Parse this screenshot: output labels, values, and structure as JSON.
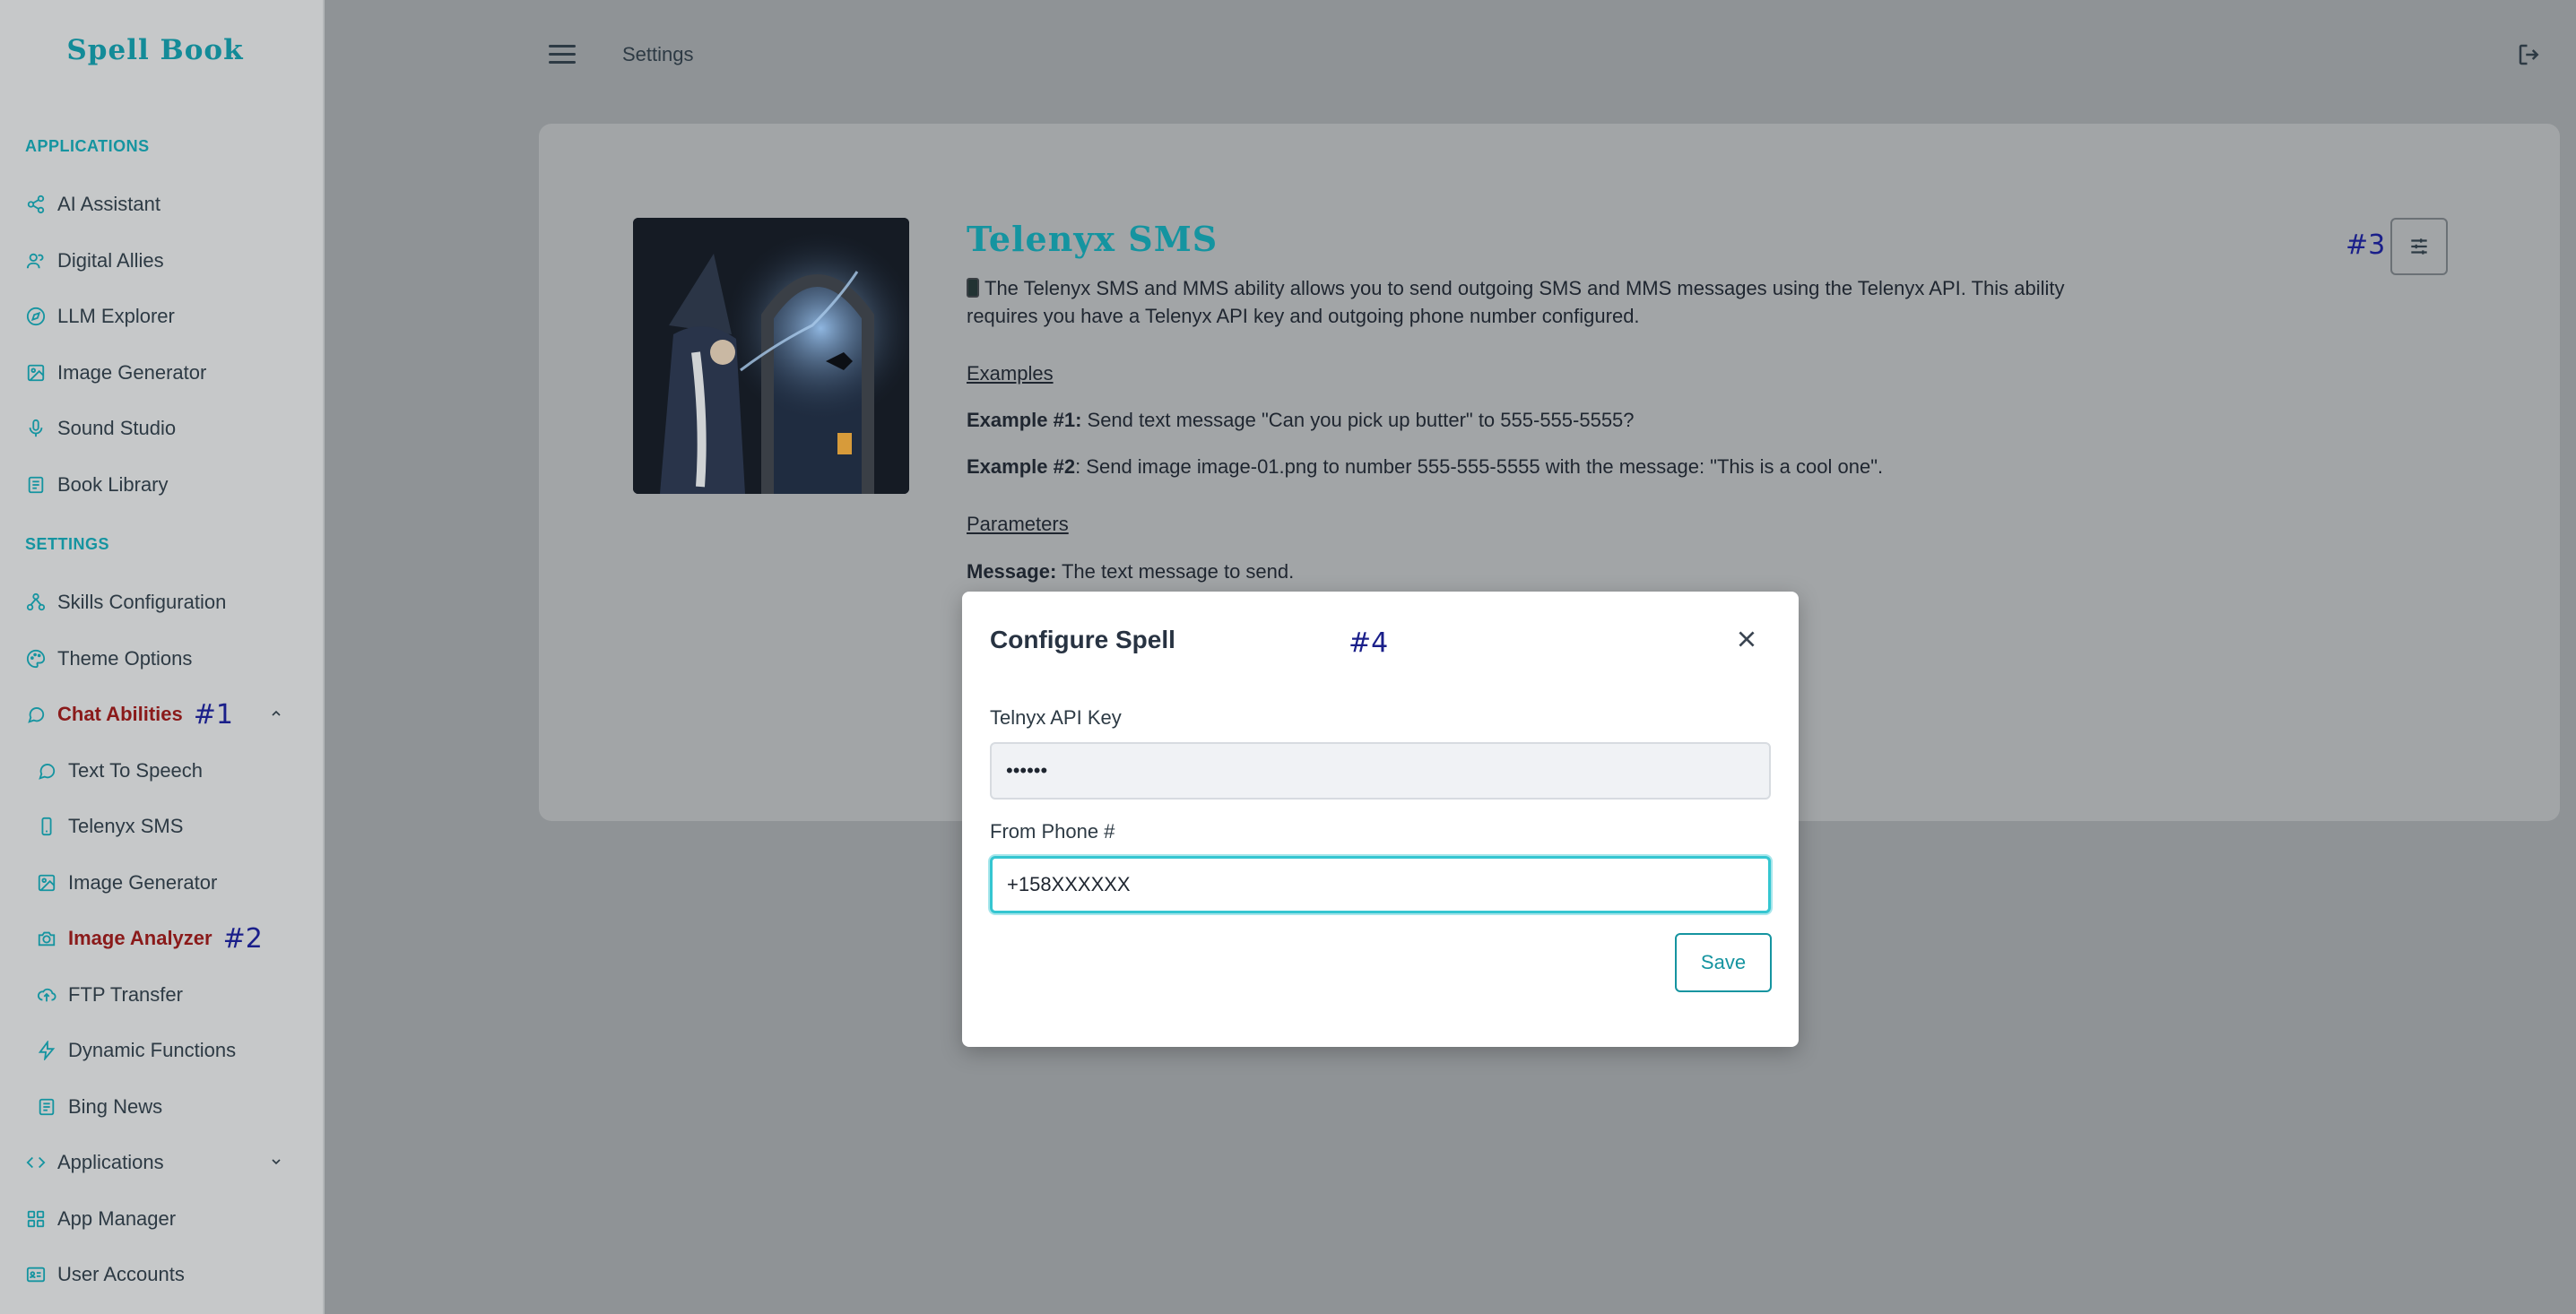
{
  "brand": "Spell Book",
  "sidebar": {
    "sections": [
      {
        "label": "APPLICATIONS",
        "items": [
          {
            "label": "AI Assistant",
            "icon": "share-nodes-icon"
          },
          {
            "label": "Digital Allies",
            "icon": "users-icon"
          },
          {
            "label": "LLM Explorer",
            "icon": "compass-icon"
          },
          {
            "label": "Image Generator",
            "icon": "image-icon"
          },
          {
            "label": "Sound Studio",
            "icon": "microphone-icon"
          },
          {
            "label": "Book Library",
            "icon": "book-icon"
          }
        ]
      },
      {
        "label": "SETTINGS",
        "items": [
          {
            "label": "Skills Configuration",
            "icon": "nodes-icon"
          },
          {
            "label": "Theme Options",
            "icon": "palette-icon"
          },
          {
            "label": "Chat Abilities",
            "icon": "chat-icon",
            "annotation": "#1",
            "expanded": true
          },
          {
            "label": "Text To Speech",
            "icon": "message-circle-icon"
          },
          {
            "label": "Telenyx SMS",
            "icon": "phone-icon"
          },
          {
            "label": "Image Generator",
            "icon": "image-icon"
          },
          {
            "label": "Image Analyzer",
            "icon": "camera-icon",
            "annotation": "#2"
          },
          {
            "label": "FTP Transfer",
            "icon": "cloud-upload-icon"
          },
          {
            "label": "Dynamic Functions",
            "icon": "bolt-icon"
          },
          {
            "label": "Bing News",
            "icon": "newspaper-icon"
          },
          {
            "label": "Applications",
            "icon": "code-icon"
          },
          {
            "label": "App Manager",
            "icon": "grid-icon"
          },
          {
            "label": "User Accounts",
            "icon": "id-card-icon"
          }
        ]
      }
    ]
  },
  "header": {
    "title": "Settings"
  },
  "card": {
    "title": "Telenyx SMS",
    "description": "The Telenyx SMS and MMS ability allows you to send outgoing SMS and MMS messages using the Telenyx API. This ability requires you have a Telenyx API key and outgoing phone number configured.",
    "examples_heading": "Examples",
    "example1_label": "Example #1:",
    "example1_text": " Send text message \"Can you pick up butter\" to 555-555-5555?",
    "example2_label": "Example #2",
    "example2_text": ": Send image image-01.png to number 555-555-5555 with the message: \"This is a cool one\".",
    "parameters_heading": "Parameters",
    "message_label": "Message:",
    "message_text": " The text message to send.",
    "annotation": "#3"
  },
  "modal": {
    "title": "Configure Spell",
    "annotation": "#4",
    "api_key_label": "Telnyx API Key",
    "api_key_value": "••••••",
    "phone_label": "From Phone #",
    "phone_value": "+158XXXXXX",
    "save_label": "Save"
  },
  "colors": {
    "accent": "#1594a0",
    "active": "#8a1a1a",
    "annotation": "#1a1f8a"
  }
}
